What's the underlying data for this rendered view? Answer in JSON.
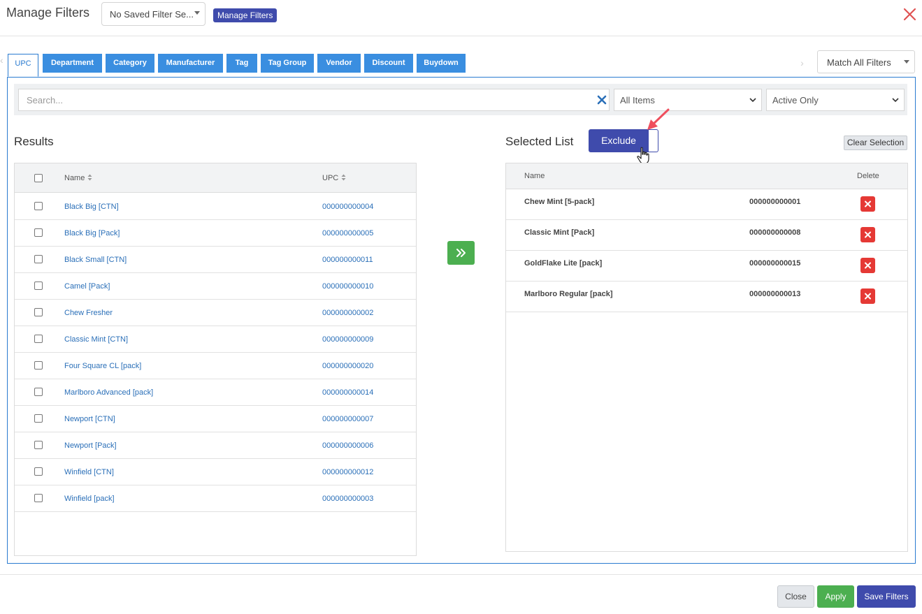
{
  "header": {
    "title": "Manage Filters",
    "saved_filter_select": "No Saved Filter Se...",
    "manage_filters_button": "Manage Filters",
    "close_icon": "close-x-icon"
  },
  "tabs": [
    {
      "label": "UPC",
      "active": true
    },
    {
      "label": "Department"
    },
    {
      "label": "Category"
    },
    {
      "label": "Manufacturer"
    },
    {
      "label": "Tag"
    },
    {
      "label": "Tag Group"
    },
    {
      "label": "Vendor"
    },
    {
      "label": "Discount"
    },
    {
      "label": "Buydown"
    }
  ],
  "match_select": "Match All Filters",
  "filters": {
    "search_placeholder": "Search...",
    "items_select": "All Items",
    "status_select": "Active Only"
  },
  "results": {
    "title": "Results",
    "columns": [
      "Name",
      "UPC"
    ],
    "rows": [
      {
        "name": "Black Big [CTN]",
        "upc": "000000000004"
      },
      {
        "name": "Black Big [Pack]",
        "upc": "000000000005"
      },
      {
        "name": "Black Small [CTN]",
        "upc": "000000000011"
      },
      {
        "name": "Camel [Pack]",
        "upc": "000000000010"
      },
      {
        "name": "Chew Fresher",
        "upc": "000000000002"
      },
      {
        "name": "Classic Mint [CTN]",
        "upc": "000000000009"
      },
      {
        "name": "Four Square CL [pack]",
        "upc": "000000000020"
      },
      {
        "name": "Marlboro Advanced [pack]",
        "upc": "000000000014"
      },
      {
        "name": "Newport [CTN]",
        "upc": "000000000007"
      },
      {
        "name": "Newport [Pack]",
        "upc": "000000000006"
      },
      {
        "name": "Winfield [CTN]",
        "upc": "000000000012"
      },
      {
        "name": "Winfield [pack]",
        "upc": "000000000003"
      }
    ]
  },
  "selected": {
    "title": "Selected List",
    "exclude_button": "Exclude",
    "clear_button": "Clear Selection",
    "columns": [
      "Name",
      "Delete"
    ],
    "rows": [
      {
        "name": "Chew Mint [5-pack]",
        "upc": "000000000001"
      },
      {
        "name": "Classic Mint [Pack]",
        "upc": "000000000008"
      },
      {
        "name": "GoldFlake Lite [pack]",
        "upc": "000000000015"
      },
      {
        "name": "Marlboro Regular [pack]",
        "upc": "000000000013"
      }
    ]
  },
  "footer": {
    "close": "Close",
    "apply": "Apply",
    "save": "Save Filters"
  },
  "colors": {
    "primary": "#3f4bac",
    "tab": "#3a8ee0",
    "success": "#4caf50",
    "danger": "#e53935"
  }
}
